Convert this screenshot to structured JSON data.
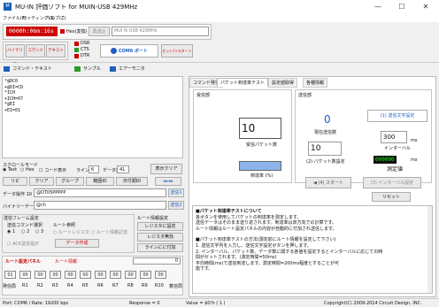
{
  "window": {
    "title": "MU-IN 評価ソフト for MUIN-USB 429MHz",
    "minimize": "—",
    "maximize": "☐",
    "close": "✕"
  },
  "menu": [
    "ファイル(F)",
    "セッティング(S)",
    "ヘルプ(Z)"
  ],
  "toolbar": {
    "time": "0000h:06m:16s",
    "hex": "Hex(変換)",
    "resend": "再送込",
    "device": "MUI N-USB  429MHz",
    "dsr": "DSR",
    "cts": "CTS",
    "dtr": "DTR",
    "bytes": "バイナリー",
    "command": "コマンド",
    "text": "テキスト",
    "com_port": "COM6 ポート",
    "reset": "セット/リスタート"
  },
  "tabs": [
    "コマンド・テキスト",
    "サンプル",
    "エアーモニタ"
  ],
  "console": [
    "*@DC0",
    "+@DI=CD",
    "*ICH",
    "+ICH=07",
    "*@EI",
    "+EI=01"
  ],
  "left": {
    "scroll_mode": "スクロールモード",
    "text_radio": "Text",
    "hex_radio": "Hex",
    "code_display": "コード表示",
    "line_count_label": "ライン数",
    "line_count": "6",
    "data_count_label": "データ数",
    "data_count": "41",
    "clear_button": "表示クリア",
    "btn_repeat": "リピ",
    "btn_clear_list": "クリア",
    "btn_group": "グループ",
    "btn_mode": "範囲ID",
    "btn_date": "日付順ID",
    "send1_label": "データ操作 10",
    "send1_value": "@DT05PPPPP",
    "send1_button": "送信1",
    "send2_label": "バイナリーデータ",
    "send2_value": "@ch",
    "send2_button": "送信2",
    "relay_title": "送信フレーム設定",
    "relay_sub": "送信コマンド選択",
    "relay_opts": [
      "1",
      "2",
      "3"
    ],
    "relay_ref": "ルート参照",
    "relay_ref_opts": [
      "ルートレジスタ",
      "ルート情報記述"
    ],
    "repeat_title": "ルート情報設定",
    "repeat_btn1": "レジスタに設定",
    "repeat_btn2": "レジスタ無効",
    "repeat_btn3": "ラインにに付加",
    "ack_check": "ACK送信指示",
    "make_data": "データ作成",
    "route_title": "ルート設定パネル",
    "route_sub": "ルート情報",
    "route_count": "0",
    "route_cells": [
      "01",
      "00",
      "00",
      "00",
      "00",
      "00",
      "00",
      "00",
      "00",
      "00",
      "00"
    ],
    "route_labels": [
      "発信局",
      "R1",
      "R2",
      "R3",
      "R4",
      "R5",
      "R6",
      "R7",
      "R8",
      "R9",
      "R10",
      "着信局"
    ]
  },
  "right": {
    "tabs": [
      "コマンド発行",
      "パケット到達率テスト",
      "設定値取得",
      "各種情報"
    ],
    "recv_label": "受信部",
    "send_label": "送信部",
    "recv_count": "10",
    "recv_caption": "受信パケット数",
    "sent_count": "0",
    "sent_caption": "現在送信数",
    "send_text_btn": "(1) 送信文字設定",
    "packets": "10",
    "packets_caption": "(2) パケット数設定",
    "interval": "300",
    "interval_unit": "ms",
    "interval_caption": "インターバル",
    "measure_value": "000000",
    "measure_unit": "ms",
    "measure_caption": "測定値",
    "rate_caption": "到達率 (%)",
    "start_btn": "(4) スタート",
    "interval_btn": "(3) インターバル設定",
    "reset_btn": "リセット",
    "info_title": "■パケット到達率テストについて",
    "info_lines": [
      "各ボタンを使用してパケットの到達率を測定します。",
      "送信データはそのまま送り返されます。到達率は双方向での計算です。",
      "ルート情報はルート設定パネルの内容が自動的に付加され送信します。",
      "",
      "■パケット到達率テストの方法(測定前にルート情報を設定して下さい)",
      "1. 送信文字列を入力し、送信文字設定ボタンを押します。",
      "2. インターバル、パケット数、データ数に関する各値を設定するとインターバルに応じての時",
      "間がセットされます。(測定時間=50ms)",
      "平均時間(ms)で送信到達します。測定時間=200ms程度とすることが可",
      "能です。"
    ]
  },
  "status": {
    "port": "Port: COM6 / Rate: 19200 bps",
    "response": "Response = 0",
    "value": "Value = $0!h ( 1 )",
    "copyright": "Copyright(C) 2009-2014 Circuit Design, INC."
  },
  "colors": {
    "accent": "#1f5fbf",
    "alert": "#cc0000",
    "lcd": "#cc0000"
  }
}
